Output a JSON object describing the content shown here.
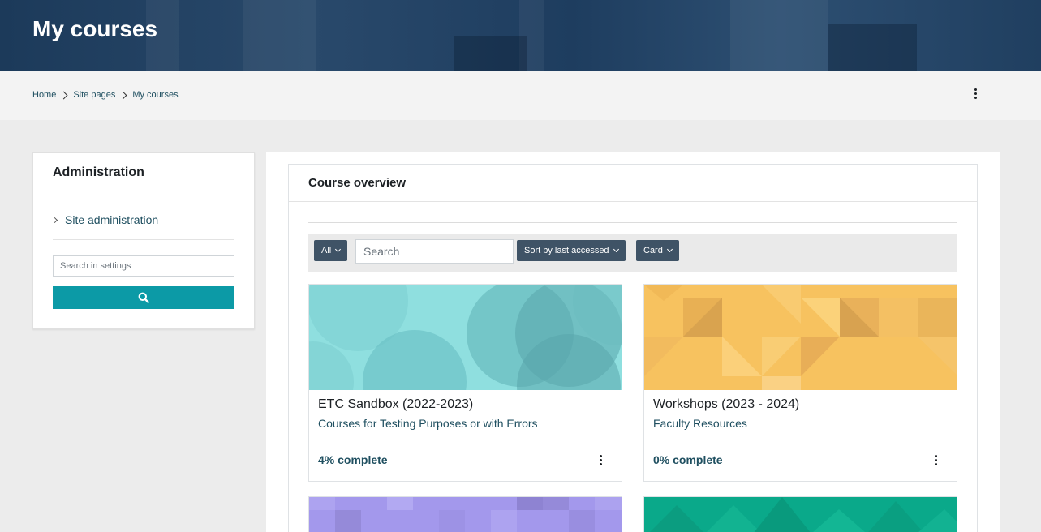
{
  "header": {
    "title": "My courses"
  },
  "breadcrumb": {
    "items": [
      "Home",
      "Site pages",
      "My courses"
    ]
  },
  "admin": {
    "title": "Administration",
    "site_admin_label": "Site administration",
    "search_placeholder": "Search in settings"
  },
  "overview": {
    "title": "Course overview",
    "filter_all": "All",
    "search_placeholder": "Search",
    "sort_label": "Sort by last accessed",
    "view_label": "Card"
  },
  "courses": [
    {
      "name": "ETC Sandbox (2022-2023)",
      "category": "Courses for Testing Purposes or with Errors",
      "progress": "4% complete",
      "image_color": "#8fdfdf"
    },
    {
      "name": "Workshops (2023 - 2024)",
      "category": "Faculty Resources",
      "progress": "0% complete",
      "image_color": "#f7c25f"
    },
    {
      "name": "",
      "category": "",
      "progress": "",
      "image_color": "#a398ec"
    },
    {
      "name": "",
      "category": "",
      "progress": "",
      "image_color": "#0aa98a"
    }
  ],
  "colors": {
    "banner": "#1f3e60",
    "accent_button": "#0c9aa6",
    "filter_button": "#3f5366",
    "link": "#1f4f60"
  }
}
